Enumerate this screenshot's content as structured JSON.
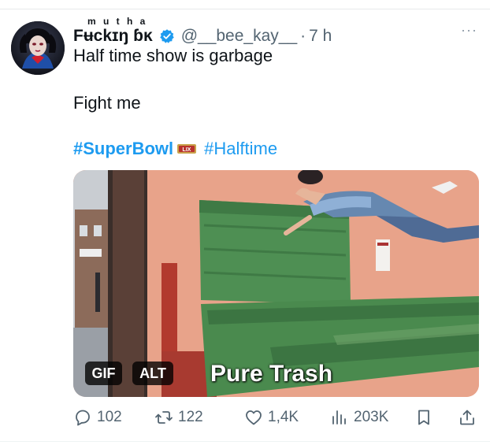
{
  "post": {
    "display_name": "Fʉckɪŋ ɓĸ",
    "display_name_super": "m u t h a",
    "handle": "@__bee_kay__",
    "separator": "·",
    "time": "7 h",
    "more_label": "···",
    "text_line_1": "Half time show is garbage",
    "text_line_2": "Fight me",
    "hashtag_1": "#SuperBowl",
    "hashtag_2": "#Halftime",
    "sb_logo_text": "LIX"
  },
  "media": {
    "gif_badge": "GIF",
    "alt_badge": "ALT",
    "caption": "Pure Trash"
  },
  "actions": {
    "replies": "102",
    "reposts": "122",
    "likes": "1,4K",
    "views": "203K"
  },
  "colors": {
    "accent": "#1d9bf0",
    "secondary_text": "#536471",
    "dumpster_green": "#4a8a4e",
    "wall_salmon": "#e8a38a"
  }
}
